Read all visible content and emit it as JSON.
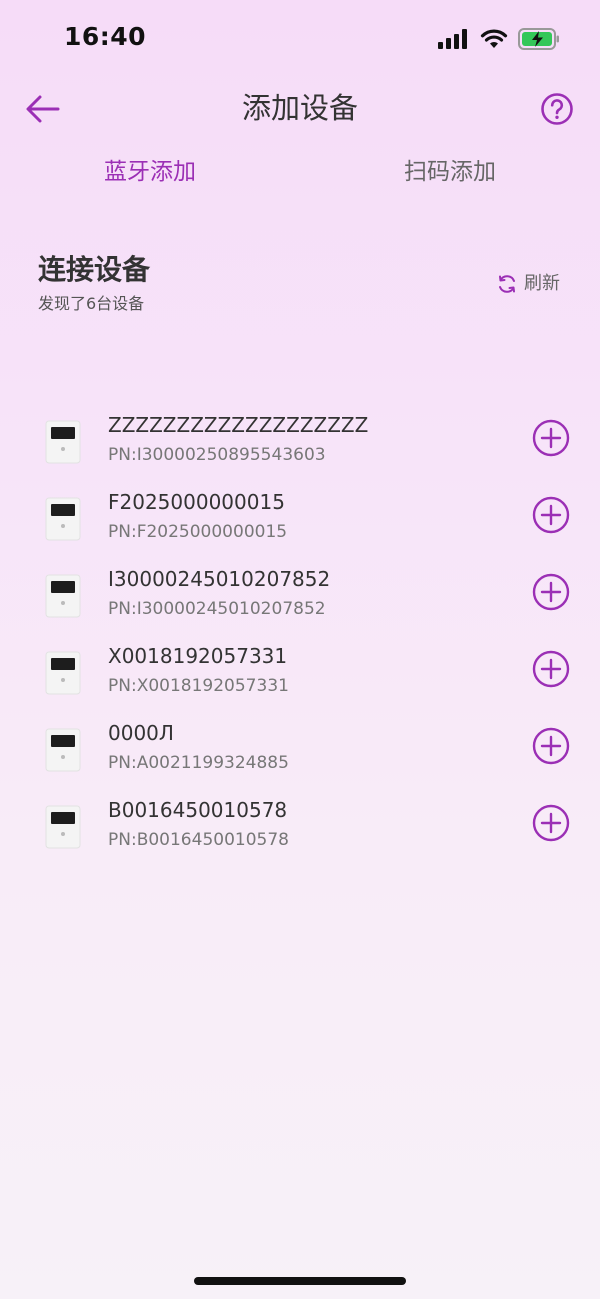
{
  "status_bar": {
    "time": "16:40"
  },
  "nav": {
    "title": "添加设备",
    "back_icon": "arrow-left-icon",
    "help_icon": "question-circle-icon"
  },
  "tabs": [
    {
      "label": "蓝牙添加",
      "active": true
    },
    {
      "label": "扫码添加",
      "active": false
    }
  ],
  "section": {
    "title": "连接设备",
    "subtitle": "发现了6台设备",
    "refresh_label": "刷新",
    "refresh_icon": "refresh-icon"
  },
  "devices": [
    {
      "name": "ZZZZZZZZZZZZZZZZZZZ",
      "pn": "PN:I30000250895543603"
    },
    {
      "name": "F2025000000015",
      "pn": "PN:F2025000000015"
    },
    {
      "name": "I30000245010207852",
      "pn": "PN:I30000245010207852"
    },
    {
      "name": "X0018192057331",
      "pn": "PN:X0018192057331"
    },
    {
      "name": "0000Л",
      "pn": "PN:A0021199324885"
    },
    {
      "name": "B0016450010578",
      "pn": "PN:B0016450010578"
    }
  ],
  "colors": {
    "accent": "#9b2fb5",
    "background_top": "#f6dcf8",
    "background_bottom": "#f7f1f8"
  }
}
